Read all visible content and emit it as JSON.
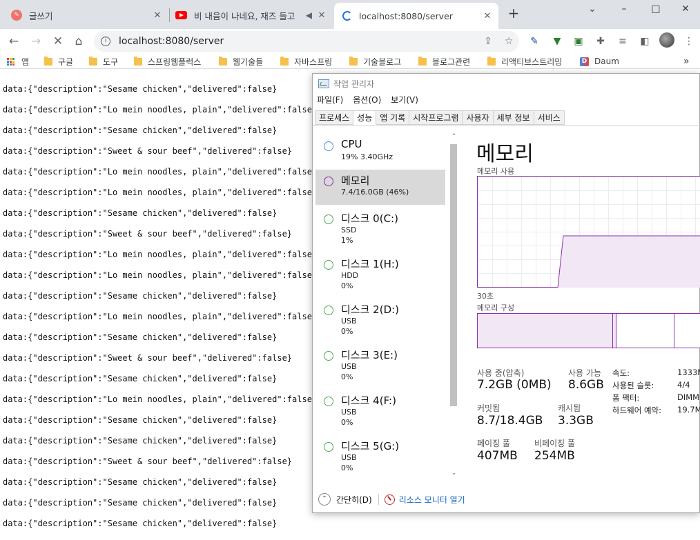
{
  "browser": {
    "tabs": [
      {
        "title": "글쓰기",
        "icon": "blog-favicon",
        "active": false
      },
      {
        "title": "비 내음이 나네요, 재즈 들고",
        "icon": "youtube-favicon",
        "active": false
      },
      {
        "title": "localhost:8080/server",
        "icon": "loading-favicon",
        "active": true
      }
    ],
    "new_tab": "+",
    "window_controls": {
      "menu": "⌄",
      "minimize": "–",
      "maximize": "□",
      "close": "✕"
    },
    "address": "localhost:8080/server",
    "bookmarks": [
      {
        "label": "앱",
        "icon": "apps-grid-icon"
      },
      {
        "label": "구글",
        "icon": "folder-icon"
      },
      {
        "label": "도구",
        "icon": "folder-icon"
      },
      {
        "label": "스프링웹플럭스",
        "icon": "folder-icon"
      },
      {
        "label": "웹기술들",
        "icon": "folder-icon"
      },
      {
        "label": "자바스프링",
        "icon": "folder-icon"
      },
      {
        "label": "기술블로그",
        "icon": "folder-icon"
      },
      {
        "label": "블로그관련",
        "icon": "folder-icon"
      },
      {
        "label": "리액티브스트리밍",
        "icon": "folder-icon"
      },
      {
        "label": "Daum",
        "icon": "daum-favicon"
      }
    ],
    "bookmarks_more": "»"
  },
  "page_lines": [
    "data:{\"description\":\"Sesame chicken\",\"delivered\":false}",
    "data:{\"description\":\"Lo mein noodles, plain\",\"delivered\":false}",
    "data:{\"description\":\"Sesame chicken\",\"delivered\":false}",
    "data:{\"description\":\"Sweet & sour beef\",\"delivered\":false}",
    "data:{\"description\":\"Lo mein noodles, plain\",\"delivered\":false}",
    "data:{\"description\":\"Lo mein noodles, plain\",\"delivered\":false}",
    "data:{\"description\":\"Sesame chicken\",\"delivered\":false}",
    "data:{\"description\":\"Sweet & sour beef\",\"delivered\":false}",
    "data:{\"description\":\"Lo mein noodles, plain\",\"delivered\":false}",
    "data:{\"description\":\"Lo mein noodles, plain\",\"delivered\":false}",
    "data:{\"description\":\"Sesame chicken\",\"delivered\":false}",
    "data:{\"description\":\"Lo mein noodles, plain\",\"delivered\":false}",
    "data:{\"description\":\"Sesame chicken\",\"delivered\":false}",
    "data:{\"description\":\"Sweet & sour beef\",\"delivered\":false}",
    "data:{\"description\":\"Sesame chicken\",\"delivered\":false}",
    "data:{\"description\":\"Lo mein noodles, plain\",\"delivered\":false}",
    "data:{\"description\":\"Sesame chicken\",\"delivered\":false}",
    "data:{\"description\":\"Sesame chicken\",\"delivered\":false}",
    "data:{\"description\":\"Sweet & sour beef\",\"delivered\":false}",
    "data:{\"description\":\"Sesame chicken\",\"delivered\":false}",
    "data:{\"description\":\"Sesame chicken\",\"delivered\":false}",
    "data:{\"description\":\"Sesame chicken\",\"delivered\":false}",
    "data:{\"description\":\"Sesame chicken\",\"delivered\":false}"
  ],
  "taskmgr": {
    "title": "작업 관리자",
    "menu": [
      "파일(F)",
      "옵션(O)",
      "보기(V)"
    ],
    "tabs": [
      "프로세스",
      "성능",
      "앱 기록",
      "시작프로그램",
      "사용자",
      "세부 정보",
      "서비스"
    ],
    "active_tab": "성능",
    "sidebar": [
      {
        "name": "CPU",
        "sub1": "19% 3.40GHz",
        "sub2": "",
        "color": "#4a90d9"
      },
      {
        "name": "메모리",
        "sub1": "7.4/16.0GB (46%)",
        "sub2": "",
        "color": "#8b2fa8",
        "selected": true
      },
      {
        "name": "디스크 0(C:)",
        "sub1": "SSD",
        "sub2": "1%",
        "color": "#4ca84c"
      },
      {
        "name": "디스크 1(H:)",
        "sub1": "HDD",
        "sub2": "0%",
        "color": "#4ca84c"
      },
      {
        "name": "디스크 2(D:)",
        "sub1": "USB",
        "sub2": "0%",
        "color": "#4ca84c"
      },
      {
        "name": "디스크 3(E:)",
        "sub1": "USB",
        "sub2": "0%",
        "color": "#4ca84c"
      },
      {
        "name": "디스크 4(F:)",
        "sub1": "USB",
        "sub2": "0%",
        "color": "#4ca84c"
      },
      {
        "name": "디스크 5(G:)",
        "sub1": "USB",
        "sub2": "0%",
        "color": "#4ca84c"
      }
    ],
    "memory": {
      "heading": "메모리",
      "usage_label": "메모리 사용",
      "time_label": "30초",
      "composition_label": "메모리 구성",
      "in_use_label": "사용 중(압축)",
      "in_use": "7.2GB (0MB)",
      "available_label": "사용 가능",
      "available": "8.6GB",
      "committed_label": "커밋됨",
      "committed": "8.7/18.4GB",
      "cached_label": "캐시됨",
      "cached": "3.3GB",
      "paged_label": "페이징 풀",
      "paged": "407MB",
      "nonpaged_label": "비페이징 풀",
      "nonpaged": "254MB",
      "speed_label": "속도:",
      "speed": "1333M",
      "slots_label": "사용된 슬롯:",
      "slots": "4/4",
      "form_label": "폼 팩터:",
      "form": "DIMM",
      "reserved_label": "하드웨어 예약:",
      "reserved": "19.7M"
    },
    "footer": {
      "less": "간단히(D)",
      "monitor": "리소스 모니터 열기"
    },
    "accent": "#8b2fa8"
  }
}
